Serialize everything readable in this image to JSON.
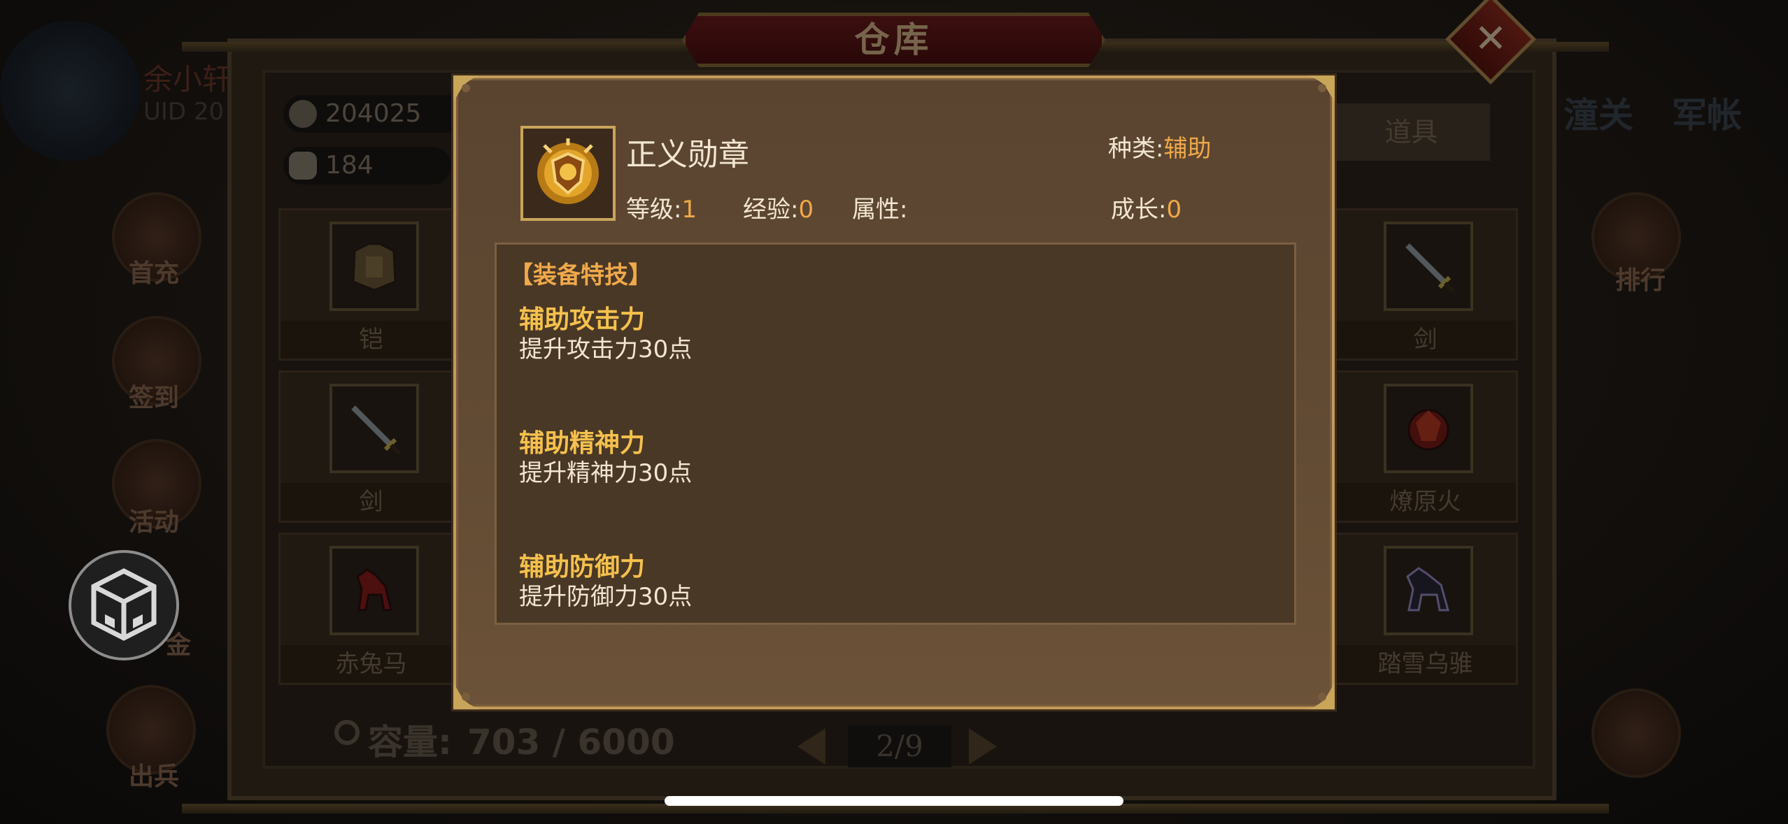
{
  "warehouse": {
    "title": "仓库",
    "close_icon": "close-icon",
    "currency": {
      "coins": "204025",
      "ingots": "184"
    },
    "player": {
      "name": "余小轩",
      "uid_label": "UID",
      "uid_value": "20"
    },
    "tab_label": "道具",
    "top_right": {
      "item1": "潼关",
      "item2": "军帐"
    },
    "side_buttons_left": [
      "首充",
      "签到",
      "活动",
      "金",
      "出兵"
    ],
    "side_buttons_right": [
      "排行"
    ],
    "slots": [
      {
        "label": "铠"
      },
      {
        "label": "剑"
      },
      {
        "label": "赤兔马"
      },
      {
        "label": "剑"
      },
      {
        "label": "燎原火"
      },
      {
        "label": "踏雪乌骓"
      }
    ],
    "capacity": {
      "label": "容量:",
      "value": "703 / 6000"
    },
    "page": "2/9"
  },
  "item_detail": {
    "name": "正义勋章",
    "type_label": "种类:",
    "type_value": "辅助",
    "level_label": "等级:",
    "level_value": "1",
    "exp_label": "经验:",
    "exp_value": "0",
    "attr_label": "属性:",
    "attr_value": "",
    "growth_label": "成长:",
    "growth_value": "0",
    "section_header": "【装备特技】",
    "skills": [
      {
        "name": "辅助攻击力",
        "desc": "提升攻击力30点"
      },
      {
        "name": "辅助精神力",
        "desc": "提升精神力30点"
      },
      {
        "name": "辅助防御力",
        "desc": "提升防御力30点"
      }
    ]
  },
  "colors": {
    "accent_orange": "#f0a94a",
    "skill_gold": "#f5c14d",
    "frame_gold": "#c29a5a"
  }
}
